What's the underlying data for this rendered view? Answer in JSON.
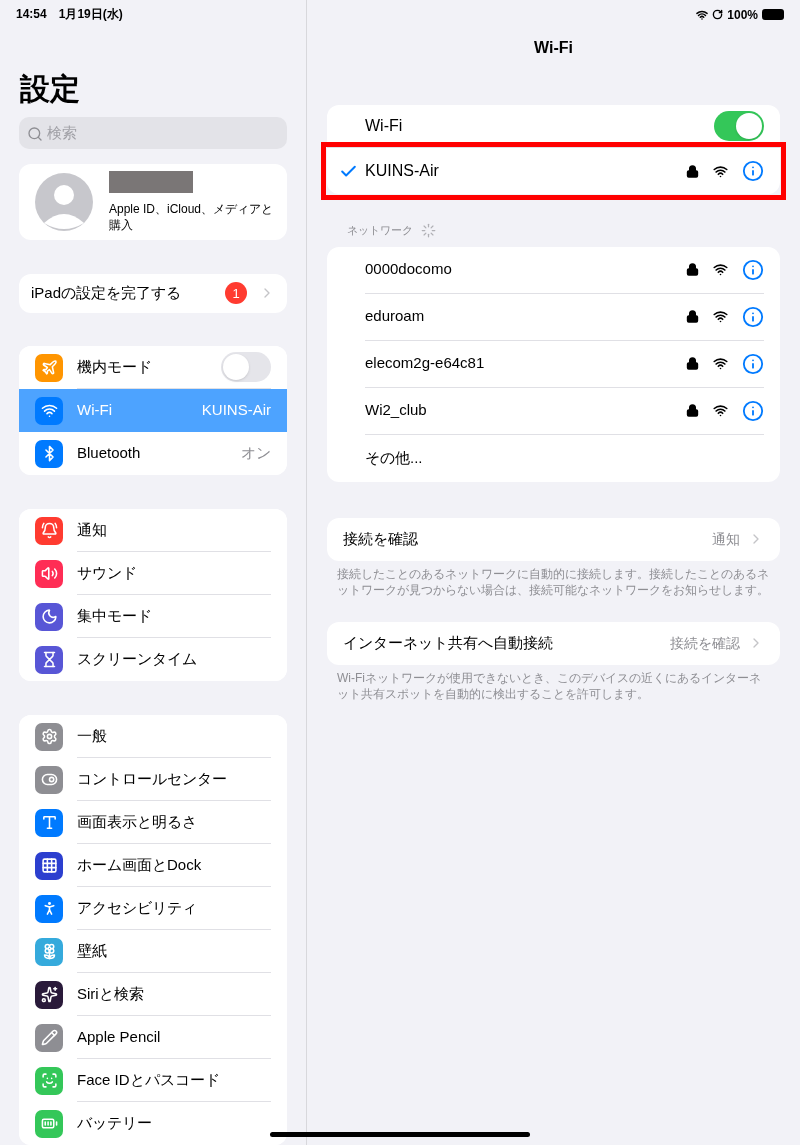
{
  "status_bar": {
    "time": "14:54",
    "date": "1月19日(水)",
    "battery": "100%"
  },
  "sidebar": {
    "title": "設定",
    "search": {
      "placeholder": "検索"
    },
    "profile": {
      "subtitle": "Apple ID、iCloud、メディアと購入"
    },
    "setup": {
      "label": "iPadの設定を完了する",
      "badge": "1"
    },
    "groups": [
      [
        {
          "label": "機内モード",
          "kind": "toggle",
          "on": false,
          "color": "#ff9500",
          "selected": false
        },
        {
          "label": "Wi-Fi",
          "kind": "value",
          "value": "KUINS-Air",
          "color": "#007aff",
          "selected": true
        },
        {
          "label": "Bluetooth",
          "kind": "value",
          "value": "オン",
          "color": "#007aff",
          "selected": false
        }
      ],
      [
        {
          "label": "通知",
          "kind": "plain",
          "color": "#ff3b30",
          "selected": false
        },
        {
          "label": "サウンド",
          "kind": "plain",
          "color": "#ff2d55",
          "selected": false
        },
        {
          "label": "集中モード",
          "kind": "plain",
          "color": "#5856d6",
          "selected": false
        },
        {
          "label": "スクリーンタイム",
          "kind": "plain",
          "color": "#5856d6",
          "selected": false
        }
      ],
      [
        {
          "label": "一般",
          "kind": "plain",
          "color": "#8e8e93",
          "selected": false
        },
        {
          "label": "コントロールセンター",
          "kind": "plain",
          "color": "#8e8e93",
          "selected": false
        },
        {
          "label": "画面表示と明るさ",
          "kind": "plain",
          "color": "#007aff",
          "selected": false
        },
        {
          "label": "ホーム画面とDock",
          "kind": "plain",
          "color": "#2c3fcf",
          "selected": false
        },
        {
          "label": "アクセシビリティ",
          "kind": "plain",
          "color": "#007aff",
          "selected": false
        },
        {
          "label": "壁紙",
          "kind": "plain",
          "color": "#35aadc",
          "selected": false
        },
        {
          "label": "Siriと検索",
          "kind": "plain",
          "color": "#2a1a3a",
          "selected": false
        },
        {
          "label": "Apple Pencil",
          "kind": "plain",
          "color": "#8e8e93",
          "selected": false
        },
        {
          "label": "Face IDとパスコード",
          "kind": "plain",
          "color": "#34c759",
          "selected": false
        },
        {
          "label": "バッテリー",
          "kind": "plain",
          "color": "#34c759",
          "selected": false
        }
      ]
    ]
  },
  "detail": {
    "title": "Wi-Fi",
    "wifi_toggle": {
      "label": "Wi-Fi",
      "on": true
    },
    "current_network": {
      "name": "KUINS-Air",
      "checked": true,
      "highlighted": true
    },
    "networks_header": "ネットワーク",
    "networks": [
      {
        "kind": "network",
        "name": "0000docomo",
        "locked": true
      },
      {
        "kind": "network",
        "name": "eduroam",
        "locked": true
      },
      {
        "kind": "network",
        "name": "elecom2g-e64c81",
        "locked": true
      },
      {
        "kind": "network",
        "name": "Wi2_club",
        "locked": true
      },
      {
        "kind": "other",
        "name": "その他..."
      }
    ],
    "sections": [
      {
        "label": "接続を確認",
        "value": "通知",
        "note": "接続したことのあるネットワークに自動的に接続します。接続したことのあるネットワークが見つからない場合は、接続可能なネットワークをお知らせします。"
      },
      {
        "label": "インターネット共有へ自動接続",
        "value": "接続を確認",
        "note": "Wi-Fiネットワークが使用できないとき、このデバイスの近くにあるインターネット共有スポットを自動的に検出することを許可します。"
      }
    ]
  }
}
